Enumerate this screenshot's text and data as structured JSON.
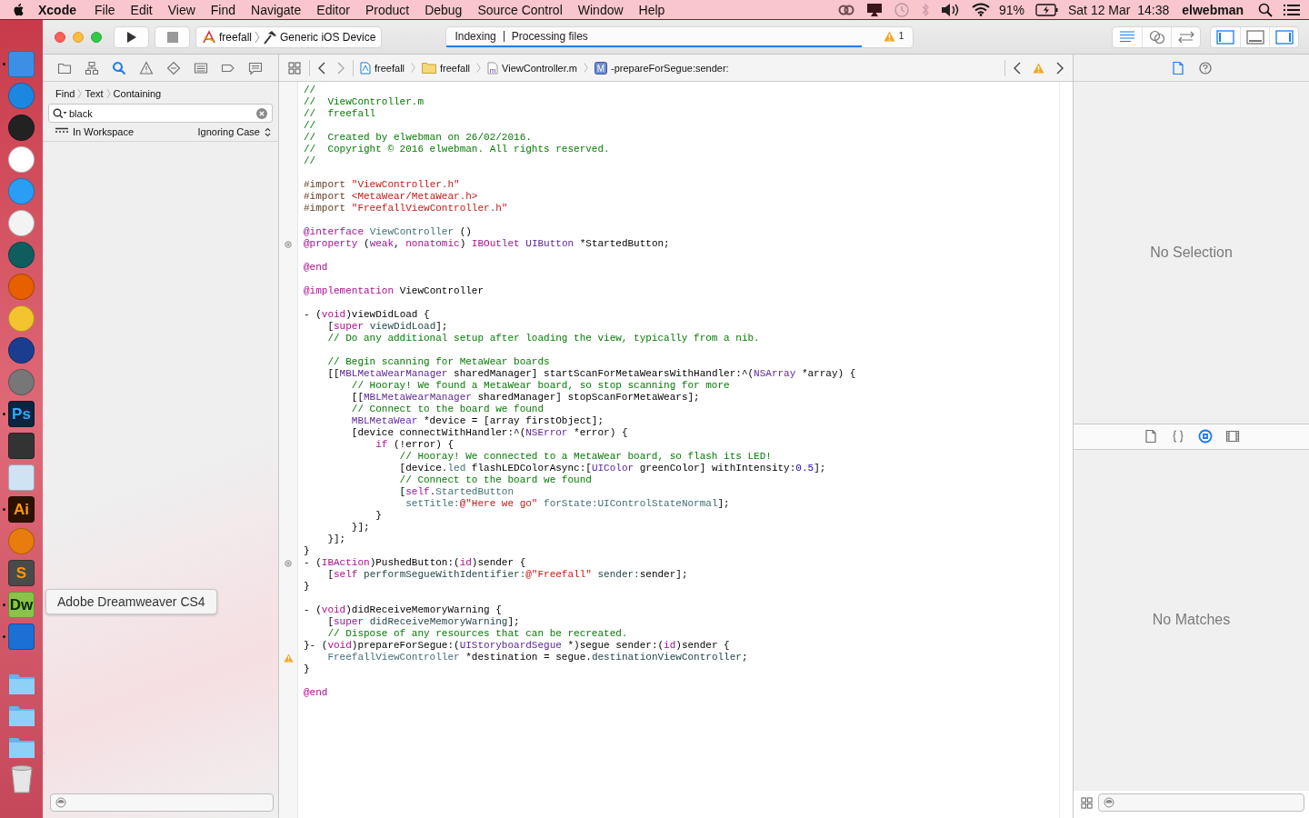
{
  "menu_bar": {
    "app": "Xcode",
    "menus": [
      "File",
      "Edit",
      "View",
      "Find",
      "Navigate",
      "Editor",
      "Product",
      "Debug",
      "Source Control",
      "Window",
      "Help"
    ],
    "battery": "91%",
    "clock": "Sat 12 Mar  14:38",
    "user": "elwebman"
  },
  "dock": {
    "apps": [
      {
        "kind": "finder",
        "running": true
      },
      {
        "kind": "appstore",
        "running": false
      },
      {
        "kind": "dashboard",
        "running": false
      },
      {
        "kind": "music",
        "running": false
      },
      {
        "kind": "safari",
        "running": false
      },
      {
        "kind": "photos",
        "running": false
      },
      {
        "kind": "timemachine",
        "running": false
      },
      {
        "kind": "firefox",
        "running": false
      },
      {
        "kind": "duck",
        "running": false
      },
      {
        "kind": "headphones",
        "running": false
      },
      {
        "kind": "gear",
        "running": false
      },
      {
        "kind": "letters",
        "label": "Ps",
        "running": true
      },
      {
        "kind": "clapper",
        "running": false
      },
      {
        "kind": "preview",
        "running": false
      },
      {
        "kind": "letters",
        "label": "Ai",
        "running": true
      },
      {
        "kind": "blender",
        "running": false
      },
      {
        "kind": "letters",
        "label": "S",
        "running": false
      },
      {
        "kind": "letters",
        "label": "Dw",
        "running": true
      },
      {
        "kind": "xcode",
        "running": true
      }
    ],
    "folders": [
      {
        "kind": "folder"
      },
      {
        "kind": "folder"
      },
      {
        "kind": "folder"
      },
      {
        "kind": "trash"
      }
    ],
    "tooltip": "Adobe Dreamweaver CS4"
  },
  "toolbar": {
    "scheme": "freefall",
    "device": "Generic iOS Device",
    "activity": {
      "status": "Indexing",
      "detail": "Processing files",
      "level": 0.89,
      "warnings": "1"
    },
    "editor_modes": [
      {
        "kind": "standard",
        "selected": true
      },
      {
        "kind": "assistant",
        "selected": false
      },
      {
        "kind": "version",
        "selected": false
      }
    ],
    "panels": [
      {
        "kind": "navigator",
        "on": true
      },
      {
        "kind": "debug",
        "on": false
      },
      {
        "kind": "utilities",
        "on": true
      }
    ]
  },
  "navigator": {
    "tabs": [
      {
        "kind": "project",
        "selected": false
      },
      {
        "kind": "symbol",
        "selected": false
      },
      {
        "kind": "find",
        "selected": true
      },
      {
        "kind": "issue",
        "selected": false
      },
      {
        "kind": "test",
        "selected": false
      },
      {
        "kind": "debug",
        "selected": false
      },
      {
        "kind": "breakpoint",
        "selected": false
      },
      {
        "kind": "report",
        "selected": false
      }
    ],
    "find_path": [
      "Find",
      "Text",
      "Containing"
    ],
    "search": {
      "value": "black"
    },
    "scope": "In Workspace",
    "matching": "Ignoring Case"
  },
  "jump_bar": {
    "path": [
      {
        "kind": "project",
        "label": "freefall"
      },
      {
        "kind": "folder",
        "label": "freefall"
      },
      {
        "kind": "source",
        "icon_letter": "m",
        "label": "ViewController.m"
      },
      {
        "kind": "method",
        "icon_letter": "M",
        "label": "-prepareForSegue:sender:"
      }
    ]
  },
  "editor": {
    "blocks": [
      {
        "lines": [
          {
            "kind": "code",
            "tokens": [
              {
                "kind": "comment",
                "text": "//"
              }
            ]
          },
          {
            "kind": "code",
            "tokens": [
              {
                "kind": "comment",
                "text": "//  ViewController.m"
              }
            ]
          },
          {
            "kind": "code",
            "tokens": [
              {
                "kind": "comment",
                "text": "//  freefall"
              }
            ]
          },
          {
            "kind": "code",
            "tokens": [
              {
                "kind": "comment",
                "text": "//"
              }
            ]
          },
          {
            "kind": "code",
            "tokens": [
              {
                "kind": "comment",
                "text": "//  Created by elwebman on 26/02/2016."
              }
            ]
          },
          {
            "kind": "code",
            "tokens": [
              {
                "kind": "comment",
                "text": "//  Copyright © 2016 elwebman. All rights reserved."
              }
            ]
          },
          {
            "kind": "code",
            "tokens": [
              {
                "kind": "comment",
                "text": "//"
              }
            ]
          }
        ]
      },
      {
        "lines": [
          {
            "kind": "code",
            "tokens": [
              {
                "kind": "preprocessor",
                "text": "#import "
              },
              {
                "kind": "string",
                "text": "\"ViewController.h\""
              }
            ]
          },
          {
            "kind": "code",
            "tokens": [
              {
                "kind": "preprocessor",
                "text": "#import "
              },
              {
                "kind": "string",
                "text": "<MetaWear/MetaWear.h>"
              }
            ]
          },
          {
            "kind": "code",
            "tokens": [
              {
                "kind": "preprocessor",
                "text": "#import "
              },
              {
                "kind": "string",
                "text": "\"FreefallViewController.h\""
              }
            ]
          }
        ]
      },
      {
        "lines": [
          {
            "kind": "code",
            "tokens": [
              {
                "kind": "keyword",
                "text": "@interface "
              },
              {
                "kind": "project",
                "text": "ViewController"
              },
              {
                "kind": "plain",
                "text": " ()"
              }
            ]
          },
          {
            "kind": "outlet",
            "tokens": [
              {
                "kind": "keyword",
                "text": "@property"
              },
              {
                "kind": "plain",
                "text": " ("
              },
              {
                "kind": "keyword",
                "text": "weak"
              },
              {
                "kind": "plain",
                "text": ", "
              },
              {
                "kind": "keyword",
                "text": "nonatomic"
              },
              {
                "kind": "plain",
                "text": ") "
              },
              {
                "kind": "keyword",
                "text": "IBOutlet "
              },
              {
                "kind": "system",
                "text": "UIButton"
              },
              {
                "kind": "plain",
                "text": " *StartedButton;"
              }
            ]
          }
        ]
      },
      {
        "lines": [
          {
            "kind": "code",
            "tokens": [
              {
                "kind": "keyword",
                "text": "@end"
              }
            ]
          }
        ]
      },
      {
        "lines": [
          {
            "kind": "code",
            "tokens": [
              {
                "kind": "keyword",
                "text": "@implementation"
              },
              {
                "kind": "plain",
                "text": " ViewController"
              }
            ]
          }
        ]
      },
      {
        "lines": [
          {
            "kind": "code",
            "tokens": [
              {
                "kind": "plain",
                "text": "- ("
              },
              {
                "kind": "keyword",
                "text": "void"
              },
              {
                "kind": "plain",
                "text": ")viewDidLoad {"
              }
            ]
          },
          {
            "kind": "code",
            "tokens": [
              {
                "kind": "plain",
                "text": "    ["
              },
              {
                "kind": "keyword",
                "text": "super "
              },
              {
                "kind": "method",
                "text": "viewDidLoad"
              },
              {
                "kind": "plain",
                "text": "];"
              }
            ]
          },
          {
            "kind": "code",
            "tokens": [
              {
                "kind": "comment",
                "text": "    // Do any additional setup after loading the view, typically from a nib."
              }
            ]
          }
        ]
      },
      {
        "lines": [
          {
            "kind": "code",
            "tokens": [
              {
                "kind": "comment",
                "text": "    // Begin scanning for MetaWear boards"
              }
            ]
          },
          {
            "kind": "code",
            "tokens": [
              {
                "kind": "plain",
                "text": "    [["
              },
              {
                "kind": "system",
                "text": "MBLMetaWearManager"
              },
              {
                "kind": "plain",
                "text": " sharedManager] startScanForMetaWearsWithHandler:^("
              },
              {
                "kind": "system",
                "text": "NSArray"
              },
              {
                "kind": "plain",
                "text": " *array) {"
              }
            ]
          },
          {
            "kind": "code",
            "tokens": [
              {
                "kind": "comment",
                "text": "        // Hooray! We found a MetaWear board, so stop scanning for more"
              }
            ]
          },
          {
            "kind": "code",
            "tokens": [
              {
                "kind": "plain",
                "text": "        [["
              },
              {
                "kind": "system",
                "text": "MBLMetaWearManager"
              },
              {
                "kind": "plain",
                "text": " sharedManager] stopScanForMetaWears];"
              }
            ]
          },
          {
            "kind": "code",
            "tokens": [
              {
                "kind": "comment",
                "text": "        // Connect to the board we found"
              }
            ]
          },
          {
            "kind": "code",
            "tokens": [
              {
                "kind": "system",
                "text": "        MBLMetaWear"
              },
              {
                "kind": "plain",
                "text": " *device = [array firstObject];"
              }
            ]
          },
          {
            "kind": "code",
            "tokens": [
              {
                "kind": "plain",
                "text": "        [device connectWithHandler:^("
              },
              {
                "kind": "system",
                "text": "NSError"
              },
              {
                "kind": "plain",
                "text": " *error) {"
              }
            ]
          },
          {
            "kind": "code",
            "tokens": [
              {
                "kind": "keyword",
                "text": "            if"
              },
              {
                "kind": "plain",
                "text": " (!error) {"
              }
            ]
          },
          {
            "kind": "code",
            "tokens": [
              {
                "kind": "comment",
                "text": "                // Hooray! We connected to a MetaWear board, so flash its LED!"
              }
            ]
          },
          {
            "kind": "code",
            "tokens": [
              {
                "kind": "plain",
                "text": "                [device."
              },
              {
                "kind": "project",
                "text": "led"
              },
              {
                "kind": "plain",
                "text": " flashLEDColorAsync:["
              },
              {
                "kind": "system",
                "text": "UIColor"
              },
              {
                "kind": "plain",
                "text": " greenColor] withIntensity:"
              },
              {
                "kind": "number",
                "text": "0.5"
              },
              {
                "kind": "plain",
                "text": "];"
              }
            ]
          },
          {
            "kind": "code",
            "tokens": [
              {
                "kind": "comment",
                "text": "                // Connect to the board we found"
              }
            ]
          },
          {
            "kind": "code",
            "tokens": [
              {
                "kind": "plain",
                "text": "                ["
              },
              {
                "kind": "keyword",
                "text": "self"
              },
              {
                "kind": "plain",
                "text": "."
              },
              {
                "kind": "project",
                "text": "StartedButton"
              }
            ]
          },
          {
            "kind": "code",
            "tokens": [
              {
                "kind": "project",
                "text": "                 setTitle:"
              },
              {
                "kind": "string",
                "text": "@\"Here we go\""
              },
              {
                "kind": "project",
                "text": " forState:UIControlStateNormal"
              },
              {
                "kind": "plain",
                "text": "];"
              }
            ]
          },
          {
            "kind": "code",
            "tokens": [
              {
                "kind": "plain",
                "text": "            }"
              }
            ]
          },
          {
            "kind": "code",
            "tokens": [
              {
                "kind": "plain",
                "text": "        }];"
              }
            ]
          },
          {
            "kind": "code",
            "tokens": [
              {
                "kind": "plain",
                "text": "    }];"
              }
            ]
          },
          {
            "kind": "code",
            "tokens": [
              {
                "kind": "plain",
                "text": "}"
              }
            ]
          },
          {
            "kind": "outlet",
            "tokens": [
              {
                "kind": "plain",
                "text": "- ("
              },
              {
                "kind": "keyword",
                "text": "IBAction"
              },
              {
                "kind": "plain",
                "text": ")PushedButton:("
              },
              {
                "kind": "keyword",
                "text": "id"
              },
              {
                "kind": "plain",
                "text": ")sender {"
              }
            ]
          },
          {
            "kind": "code",
            "tokens": [
              {
                "kind": "plain",
                "text": "    ["
              },
              {
                "kind": "keyword",
                "text": "self "
              },
              {
                "kind": "method",
                "text": "performSegueWithIdentifier:"
              },
              {
                "kind": "string",
                "text": "@\"Freefall\""
              },
              {
                "kind": "method",
                "text": " sender:"
              },
              {
                "kind": "plain",
                "text": "sender];"
              }
            ]
          },
          {
            "kind": "code",
            "tokens": [
              {
                "kind": "plain",
                "text": "}"
              }
            ]
          }
        ]
      },
      {
        "lines": [
          {
            "kind": "code",
            "tokens": [
              {
                "kind": "plain",
                "text": "- ("
              },
              {
                "kind": "keyword",
                "text": "void"
              },
              {
                "kind": "plain",
                "text": ")didReceiveMemoryWarning {"
              }
            ]
          },
          {
            "kind": "code",
            "tokens": [
              {
                "kind": "plain",
                "text": "    ["
              },
              {
                "kind": "keyword",
                "text": "super "
              },
              {
                "kind": "method",
                "text": "didReceiveMemoryWarning"
              },
              {
                "kind": "plain",
                "text": "];"
              }
            ]
          },
          {
            "kind": "code",
            "tokens": [
              {
                "kind": "comment",
                "text": "    // Dispose of any resources that can be recreated."
              }
            ]
          },
          {
            "kind": "code",
            "tokens": [
              {
                "kind": "plain",
                "text": "}- ("
              },
              {
                "kind": "keyword",
                "text": "void"
              },
              {
                "kind": "plain",
                "text": ")prepareForSegue:("
              },
              {
                "kind": "system",
                "text": "UIStoryboardSegue"
              },
              {
                "kind": "plain",
                "text": " *)segue sender:("
              },
              {
                "kind": "keyword",
                "text": "id"
              },
              {
                "kind": "plain",
                "text": ")sender {"
              }
            ]
          },
          {
            "kind": "warning",
            "tokens": [
              {
                "kind": "project",
                "text": "    FreefallViewController"
              },
              {
                "kind": "plain",
                "text": " *destination = segue."
              },
              {
                "kind": "method",
                "text": "destinationViewController"
              },
              {
                "kind": "plain",
                "text": ";"
              }
            ]
          },
          {
            "kind": "code",
            "tokens": [
              {
                "kind": "plain",
                "text": "}"
              }
            ]
          }
        ]
      },
      {
        "lines": [
          {
            "kind": "code",
            "tokens": [
              {
                "kind": "keyword",
                "text": "@end"
              }
            ]
          }
        ]
      }
    ]
  },
  "inspector": {
    "tabs": [
      {
        "kind": "file",
        "selected": true
      },
      {
        "kind": "help",
        "selected": false
      }
    ],
    "message": "No Selection"
  },
  "library": {
    "tabs": [
      {
        "kind": "file",
        "selected": false
      },
      {
        "kind": "snippet",
        "selected": false
      },
      {
        "kind": "object",
        "selected": true
      },
      {
        "kind": "media",
        "selected": false
      }
    ],
    "message": "No Matches"
  }
}
